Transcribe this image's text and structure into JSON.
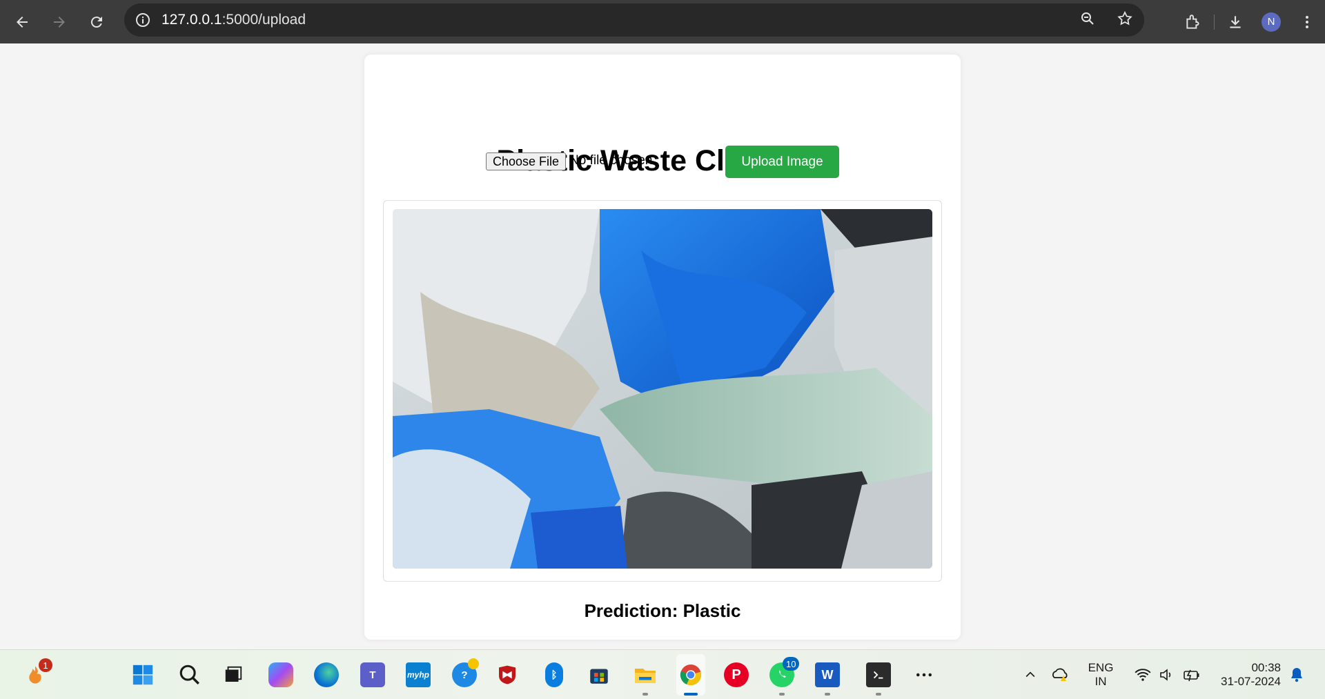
{
  "browser": {
    "url_host": "127.0.0.1",
    "url_path": ":5000/upload",
    "profile_initial": "N",
    "icons": [
      "back-icon",
      "forward-icon",
      "reload-icon",
      "site-info-icon",
      "zoom-icon",
      "bookmark-star-icon",
      "extensions-icon",
      "download-icon",
      "more-icon"
    ]
  },
  "page": {
    "title": "Plastic Waste Classifier",
    "choose_file_label": "Choose File",
    "no_file_text": "No file chosen",
    "upload_button": "Upload Image",
    "prediction_text": "Prediction: Plastic"
  },
  "colors": {
    "upload_button": "#28a745",
    "chrome_bg": "#3c3c3c",
    "page_bg": "#f4f4f4"
  },
  "taskbar": {
    "widgets_badge": "1",
    "whatsapp_badge": "10",
    "apps": [
      "start-icon",
      "search-icon",
      "task-view-icon",
      "copilot-icon",
      "edge-icon",
      "teams-icon",
      "myhp-icon",
      "help-icon",
      "mcafee-icon",
      "bluetooth-icon",
      "store-icon",
      "file-explorer-icon",
      "chrome-icon",
      "pinterest-icon",
      "whatsapp-icon",
      "word-icon",
      "terminal-icon",
      "more-apps-icon"
    ],
    "myhp_label": "myhp",
    "word_label": "W",
    "lang_top": "ENG",
    "lang_bottom": "IN",
    "time": "00:38",
    "date": "31-07-2024"
  }
}
